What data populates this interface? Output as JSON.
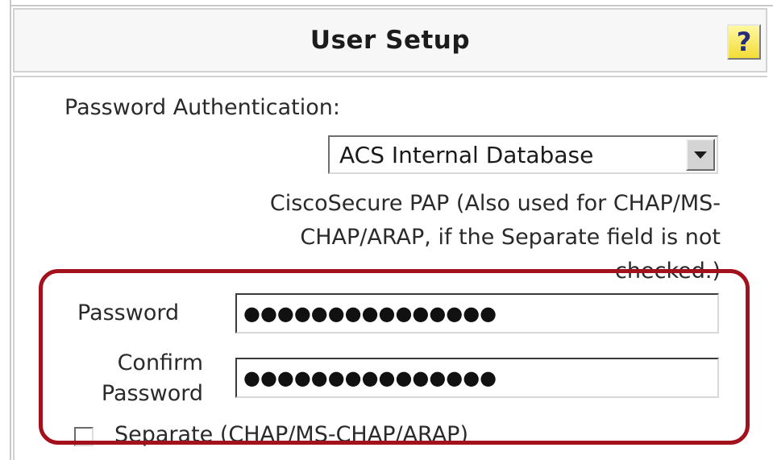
{
  "header": {
    "title": "User Setup",
    "help_label": "?"
  },
  "auth": {
    "label": "Password Authentication:",
    "selected": "ACS Internal Database"
  },
  "description": {
    "line1": "CiscoSecure PAP (Also used for CHAP/MS-",
    "line2": "CHAP/ARAP, if the Separate field is not",
    "line3": "checked.)"
  },
  "password": {
    "label": "Password",
    "masked_value": "●●●●●●●●●●●●●●●"
  },
  "confirm": {
    "label_line1": "Confirm",
    "label_line2": "Password",
    "masked_value": "●●●●●●●●●●●●●●●"
  },
  "separate": {
    "label": "Separate (CHAP/MS-CHAP/ARAP)",
    "checked": false
  },
  "colors": {
    "highlight": "#a3111c",
    "help_button": "#f2dc36"
  }
}
